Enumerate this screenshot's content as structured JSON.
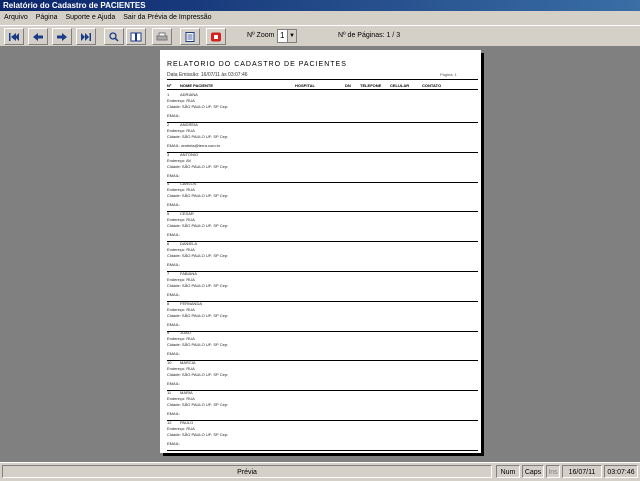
{
  "window": {
    "title": "Relatório do Cadastro de PACIENTES"
  },
  "menu": [
    "Arquivo",
    "Página",
    "Suporte e Ajuda",
    "Sair da Prévia de Impressão"
  ],
  "toolbar": {
    "buttons": [
      {
        "name": "first-page-button",
        "icon": "first-arrow-icon"
      },
      {
        "name": "prev-page-button",
        "icon": "left-arrow-icon"
      },
      {
        "name": "next-page-button",
        "icon": "right-arrow-icon"
      },
      {
        "name": "last-page-button",
        "icon": "last-arrow-icon"
      },
      {
        "name": "zoom-button",
        "icon": "magnifier-icon"
      },
      {
        "name": "two-pages-button",
        "icon": "book-icon"
      },
      {
        "name": "print-button",
        "icon": "printer-icon"
      },
      {
        "name": "export-button",
        "icon": "document-icon"
      },
      {
        "name": "close-preview-button",
        "icon": "stop-icon"
      }
    ],
    "zoom_label": "Nº Zoom",
    "zoom_value": "1",
    "pages_label": "Nº de Páginas: 1 / 3"
  },
  "report": {
    "title": "RELATORIO DO CADASTRO DE PACIENTES",
    "subtitle": "Data Emissão: 16/07/11 às 03:07:46",
    "header_right": "Página: 1",
    "columns": [
      "Nº",
      "NOME PACIENTE",
      "HOSPITAL",
      "DN",
      "TELEFONE",
      "CELULAR",
      "CONTATO"
    ],
    "records": [
      {
        "num": "1",
        "name": "ADRIANA",
        "line2": "Endereço: RUA",
        "line3": "Cidade: SÃO PAULO  UF: SP  Cep:",
        "email": "EMAIL:"
      },
      {
        "num": "2",
        "name": "ANDREIA",
        "line2": "Endereço: RUA",
        "line3": "Cidade: SÃO PAULO  UF: SP  Cep:",
        "email": "EMAIL: andreia@terra.com.br"
      },
      {
        "num": "3",
        "name": "ANTONIO",
        "line2": "Endereço: AV",
        "line3": "Cidade: SÃO PAULO  UF: SP  Cep:",
        "email": "EMAIL:"
      },
      {
        "num": "4",
        "name": "CARLOS",
        "line2": "Endereço: RUA",
        "line3": "Cidade: SÃO PAULO  UF: SP  Cep:",
        "email": "EMAIL:"
      },
      {
        "num": "5",
        "name": "CESAR",
        "line2": "Endereço: RUA",
        "line3": "Cidade: SÃO PAULO  UF: SP  Cep:",
        "email": "EMAIL:"
      },
      {
        "num": "6",
        "name": "DANIELA",
        "line2": "Endereço: RUA",
        "line3": "Cidade: SÃO PAULO  UF: SP  Cep:",
        "email": "EMAIL:"
      },
      {
        "num": "7",
        "name": "FABIANA",
        "line2": "Endereço: RUA",
        "line3": "Cidade: SÃO PAULO  UF: SP  Cep:",
        "email": "EMAIL:"
      },
      {
        "num": "8",
        "name": "FERNANDA",
        "line2": "Endereço: RUA",
        "line3": "Cidade: SÃO PAULO  UF: SP  Cep:",
        "email": "EMAIL:"
      },
      {
        "num": "9",
        "name": "JOAO",
        "line2": "Endereço: RUA",
        "line3": "Cidade: SÃO PAULO  UF: SP  Cep:",
        "email": "EMAIL:"
      },
      {
        "num": "10",
        "name": "MARCIA",
        "line2": "Endereço: RUA",
        "line3": "Cidade: SÃO PAULO  UF: SP  Cep:",
        "email": "EMAIL:"
      },
      {
        "num": "11",
        "name": "MARIA",
        "line2": "Endereço: RUA",
        "line3": "Cidade: SÃO PAULO  UF: SP  Cep:",
        "email": "EMAIL:"
      },
      {
        "num": "12",
        "name": "PAULO",
        "line2": "Endereço: RUA",
        "line3": "Cidade: SÃO PAULO  UF: SP  Cep:",
        "email": "EMAIL:"
      }
    ]
  },
  "status": {
    "mode": "Prévia",
    "num": "Num",
    "caps": "Caps",
    "ins": "Ins",
    "date": "16/07/11",
    "time": "03:07:46"
  }
}
